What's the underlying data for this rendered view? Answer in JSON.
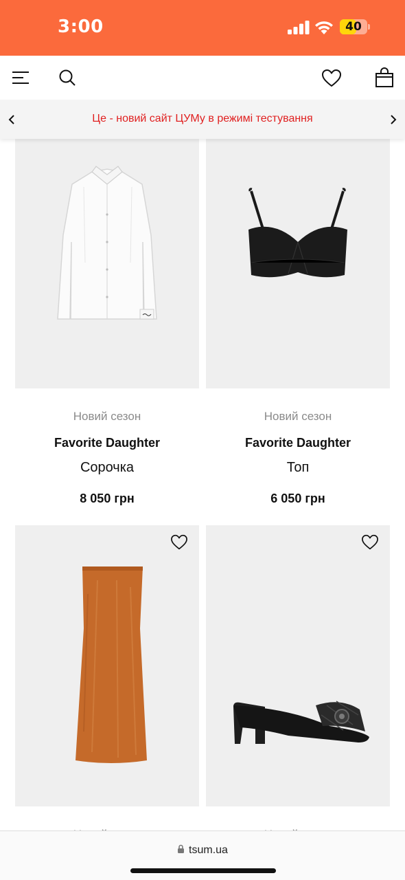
{
  "status_bar": {
    "time": "3:00",
    "battery": "40",
    "battery_level": 0.4,
    "background": "#fb6a3c"
  },
  "header": {
    "icons": [
      "menu-icon",
      "search-icon",
      "heart-icon",
      "shopping-bag-icon"
    ]
  },
  "banner": {
    "text": "Це - новий сайт ЦУМу в режимі тестування",
    "text_color": "#e02020"
  },
  "products": [
    {
      "season": "Новий сезон",
      "brand": "Favorite Daughter",
      "name": "Сорочка",
      "price": "8 050 грн"
    },
    {
      "season": "Новий сезон",
      "brand": "Favorite Daughter",
      "name": "Топ",
      "price": "6 050 грн"
    },
    {
      "season": "Новий сезон",
      "brand": "",
      "name": "",
      "price": ""
    },
    {
      "season": "Новий сезон",
      "brand": "",
      "name": "",
      "price": ""
    }
  ],
  "browser": {
    "url": "tsum.ua"
  }
}
